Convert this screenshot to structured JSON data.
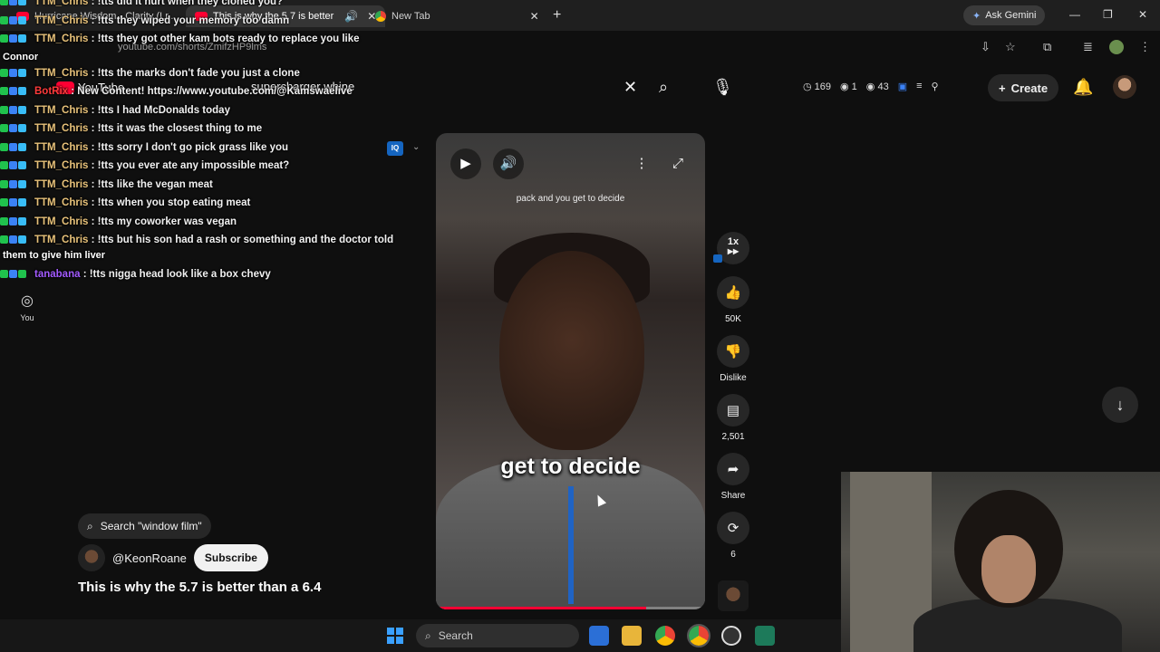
{
  "browser": {
    "tabs": [
      {
        "label": "Hurricane Wisdom - Clarity (Lr...",
        "closable": true
      },
      {
        "label": "This is why the 5.7 is better",
        "closable": true,
        "audio": true,
        "active": true
      },
      {
        "label": "New Tab",
        "closable": true
      }
    ],
    "gemini_label": "Ask Gemini",
    "url": "youtube.com/shorts/ZmifzHP9lms"
  },
  "header": {
    "logo_text": "YouTube",
    "search_query": "supercharger whine",
    "stats": {
      "views": "169",
      "users": "1",
      "watching": "43"
    },
    "create_label": "Create"
  },
  "nav": {
    "you_label": "You"
  },
  "chat": {
    "messages": [
      {
        "user": "TTM_Chris",
        "text": ": !tts did it hurt when they cloned you?"
      },
      {
        "user": "TTM_Chris",
        "text": ": !tts they wiped your memory too damn"
      },
      {
        "user": "TTM_Chris",
        "text": ": !tts they got other kam bots ready to replace you like"
      },
      {
        "user": "",
        "text": "Connor"
      },
      {
        "user": "TTM_Chris",
        "text": ": !tts the marks don't fade you just a clone"
      },
      {
        "user": "BotRix",
        "text": ": New Content! https://www.youtube.com/@Kamswaelive"
      },
      {
        "user": "TTM_Chris",
        "text": ": !tts I had McDonalds today"
      },
      {
        "user": "TTM_Chris",
        "text": ": !tts it was the closest thing to me"
      },
      {
        "user": "TTM_Chris",
        "text": ": !tts sorry I don't go pick grass like you"
      },
      {
        "user": "TTM_Chris",
        "text": ": !tts you ever ate any impossible meat?"
      },
      {
        "user": "TTM_Chris",
        "text": ": !tts like the vegan meat"
      },
      {
        "user": "TTM_Chris",
        "text": ": !tts when you stop eating meat"
      },
      {
        "user": "TTM_Chris",
        "text": ": !tts my coworker was vegan"
      },
      {
        "user": "TTM_Chris",
        "text": ": !tts but his son had a rash or something and the doctor told"
      },
      {
        "user": "",
        "text": "them to give him liver"
      },
      {
        "user": "tanabana",
        "text": ": !tts nigga head look like a box chevy"
      }
    ]
  },
  "player": {
    "caption_top": "pack and you get to decide",
    "caption_big": "get to decide",
    "progress": 0.78
  },
  "actions": {
    "speed": "1x",
    "like_count": "50K",
    "dislike_label": "Dislike",
    "comment_count": "2,501",
    "share_label": "Share",
    "remix_count": "6"
  },
  "info": {
    "search_chip": "Search \"window film\"",
    "channel": "@KeonRoane",
    "subscribe_label": "Subscribe",
    "title": "This is why the 5.7 is better than a 6.4"
  },
  "taskbar": {
    "search_label": "Search"
  },
  "colors": {
    "accent_red": "#ff0033",
    "chat_user": "#e8c27a",
    "bot_user": "#ff3b3b",
    "tana_user": "#a35bff"
  }
}
